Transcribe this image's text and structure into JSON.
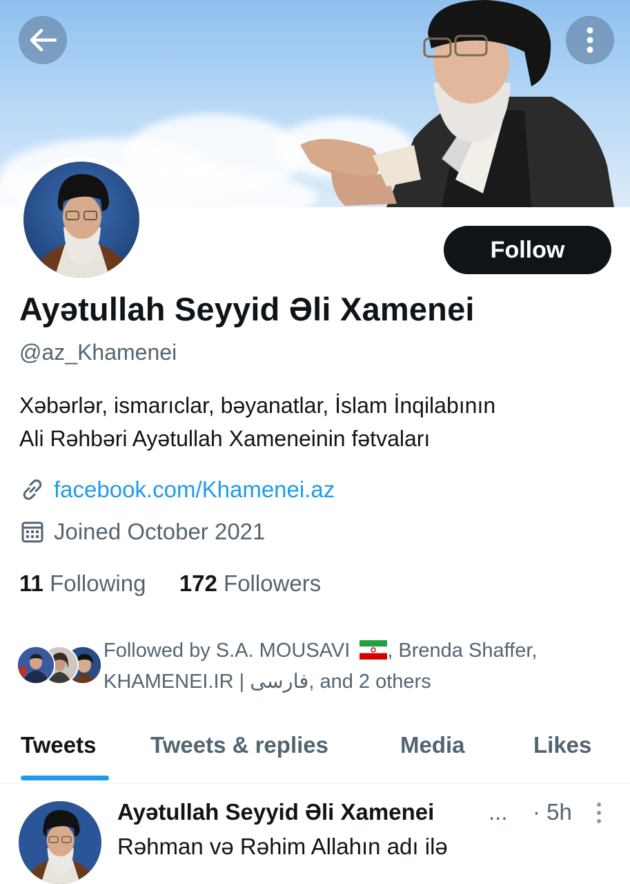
{
  "profile": {
    "display_name": "Ayətullah Seyyid Əli Xamenei",
    "handle": "@az_Khamenei",
    "bio_line1": "Xəbərlər, ismarıclar, bəyanatlar, İslam İnqilabının",
    "bio_line2": "Ali Rəhbəri Ayətullah Xameneinin fətvaları",
    "website": "facebook.com/Khamenei.az",
    "joined": "Joined October 2021",
    "following_count": "11",
    "following_label": "Following",
    "followers_count": "172",
    "followers_label": "Followers"
  },
  "actions": {
    "follow_label": "Follow"
  },
  "followed_by": {
    "line1_a": "Followed by S.A. MOUSAVI",
    "line1_b": ", Brenda Shaffer,",
    "line2": "KHAMENEI.IR | فارسی, and 2 others"
  },
  "tabs": [
    {
      "label": "Tweets",
      "active": true
    },
    {
      "label": "Tweets & replies",
      "active": false
    },
    {
      "label": "Media",
      "active": false
    },
    {
      "label": "Likes",
      "active": false
    }
  ],
  "tweet": {
    "author": "Ayətullah Seyyid Əli Xamenei",
    "ellipsis": "...",
    "time": "· 5h",
    "text": "Rəhman və Rəhim Allahın adı ilə"
  },
  "colors": {
    "accent": "#1d9bf0",
    "text": "#0f1419",
    "muted": "#536471",
    "button_bg": "#0f1419"
  },
  "icons": [
    "back-arrow-icon",
    "more-vertical-icon",
    "link-icon",
    "calendar-icon",
    "iran-flag-icon",
    "tweet-more-icon"
  ]
}
